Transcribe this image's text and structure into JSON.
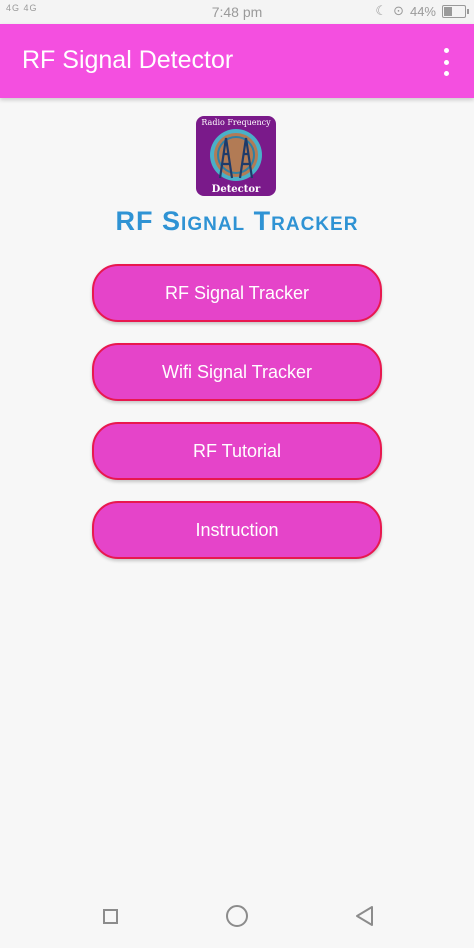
{
  "status_bar": {
    "network": "4G 4G",
    "time": "7:48 pm",
    "battery": "44%",
    "battery_level": 0.44
  },
  "app_bar": {
    "title": "RF Signal Detector",
    "color": "#f44fe0"
  },
  "logo": {
    "top_text": "Radio Frequency",
    "bottom_text": "Detector"
  },
  "headline": "RF Signal Tracker",
  "buttons": [
    {
      "label": "RF Signal Tracker"
    },
    {
      "label": "Wifi Signal Tracker"
    },
    {
      "label": "RF Tutorial"
    },
    {
      "label": "Instruction"
    }
  ],
  "colors": {
    "button_fill": "#e544c9",
    "button_border": "#e8184f",
    "headline": "#2f93d4"
  },
  "nav_bar": {
    "icons": [
      "recent-apps-icon",
      "home-icon",
      "back-icon"
    ]
  }
}
